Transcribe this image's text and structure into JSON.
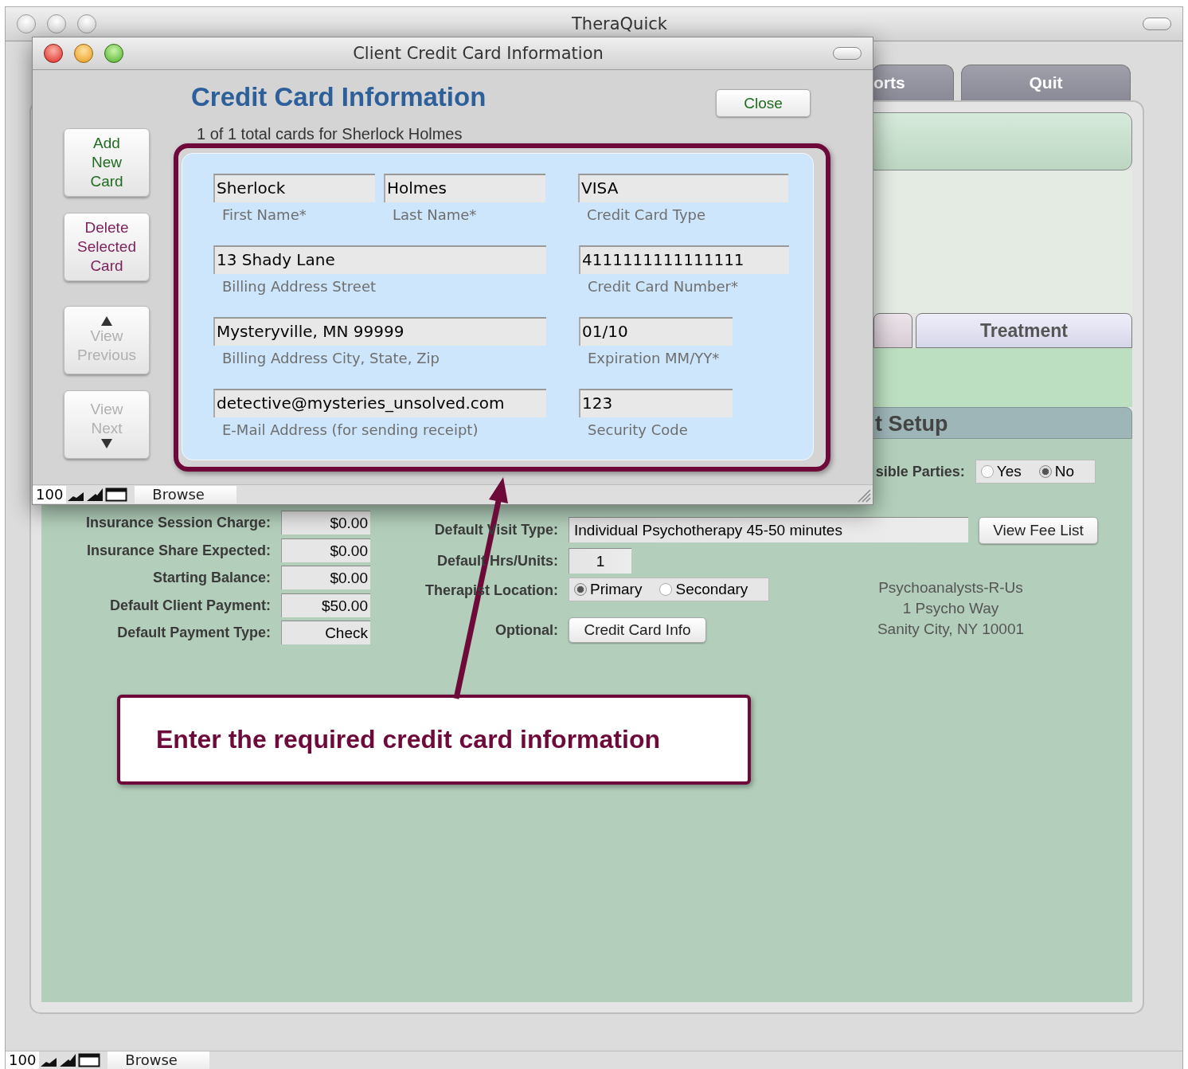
{
  "app_window": {
    "title": "TheraQuick"
  },
  "main_tabs": [
    {
      "label": "orts"
    },
    {
      "label": "Quit"
    }
  ],
  "sub_tabs": [
    {
      "label": "Treatment"
    }
  ],
  "section_title": "t Setup",
  "responsible_parties": {
    "label": "sible Parties:",
    "options": [
      {
        "label": "Yes",
        "selected": false
      },
      {
        "label": "No",
        "selected": true
      }
    ]
  },
  "billing_fields": [
    {
      "label": "Insurance Session Charge:",
      "value": "$0.00"
    },
    {
      "label": "Insurance Share Expected:",
      "value": "$0.00"
    },
    {
      "label": "Starting Balance:",
      "value": "$0.00"
    },
    {
      "label": "Default Client Payment:",
      "value": "$50.00"
    },
    {
      "label": "Default Payment Type:",
      "value": "Check"
    }
  ],
  "visit_fields": [
    {
      "kind": "text",
      "label": "Default Visit Type:",
      "value": "Individual Psychotherapy 45-50 minutes"
    },
    {
      "kind": "number",
      "label": "Default Hrs/Units:",
      "value": "1"
    },
    {
      "kind": "radio",
      "label": "Therapist Location:",
      "options": [
        {
          "label": "Primary",
          "selected": true
        },
        {
          "label": "Secondary",
          "selected": false
        }
      ]
    },
    {
      "kind": "button",
      "label": "Optional:",
      "button": "Credit Card Info"
    }
  ],
  "view_fee_button": "View Fee List",
  "practice_address": [
    "Psychoanalysts-R-Us",
    "1 Psycho Way",
    "Sanity City, NY 10001"
  ],
  "status_bar": {
    "zoom": "100",
    "mode": "Browse"
  },
  "dialog": {
    "title": "Client Credit Card Information",
    "heading": "Credit Card Information",
    "close_button": "Close",
    "summary": "1 of 1 total cards for Sherlock Holmes",
    "side_buttons": [
      {
        "kind": "add",
        "label": "Add New Card",
        "disabled": false
      },
      {
        "kind": "delete",
        "label": "Delete Selected Card",
        "disabled": false
      },
      {
        "kind": "previous",
        "label": "View Previous",
        "disabled": true
      },
      {
        "kind": "next",
        "label": "View Next",
        "disabled": true
      }
    ],
    "field_rows": [
      [
        {
          "kind": "name",
          "value": "Sherlock",
          "label": "First Name*"
        },
        {
          "kind": "name",
          "value": "Holmes",
          "label": "Last Name*"
        },
        {
          "kind": "card",
          "value": "VISA",
          "label": "Credit Card Type"
        }
      ],
      [
        {
          "kind": "wide",
          "value": "13 Shady Lane",
          "label": "Billing Address Street"
        },
        {
          "kind": "card",
          "value": "4111111111111111",
          "label": "Credit Card Number*"
        }
      ],
      [
        {
          "kind": "wide",
          "value": "Mysteryville, MN 99999",
          "label": "Billing Address City, State, Zip"
        },
        {
          "kind": "short",
          "value": "01/10",
          "label": "Expiration MM/YY*"
        }
      ],
      [
        {
          "kind": "wide",
          "value": "detective@mysteries_unsolved.com",
          "label": "E-Mail Address (for sending receipt)"
        },
        {
          "kind": "short",
          "value": "123",
          "label": "Security Code"
        }
      ]
    ],
    "status_bar": {
      "zoom": "100",
      "mode": "Browse"
    }
  },
  "callout": {
    "text": "Enter the required credit card information"
  }
}
